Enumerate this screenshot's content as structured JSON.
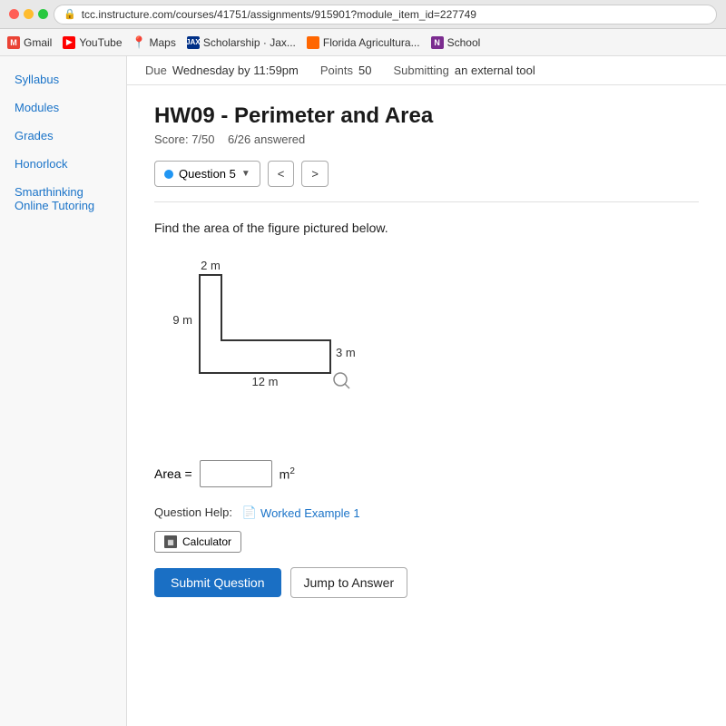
{
  "browser": {
    "url": "tcc.instructure.com/courses/41751/assignments/915901?module_item_id=227749",
    "lock_icon": "🔒"
  },
  "bookmarks": [
    {
      "id": "gmail",
      "label": "Gmail",
      "icon": "M",
      "color": "#EA4335"
    },
    {
      "id": "youtube",
      "label": "YouTube",
      "icon": "▶",
      "color": "#FF0000"
    },
    {
      "id": "maps",
      "label": "Maps",
      "icon": "📍",
      "color": "#4285F4"
    },
    {
      "id": "scholarship",
      "label": "Scholarship · Jax...",
      "icon": "JAX",
      "color": "#003087"
    },
    {
      "id": "famu",
      "label": "Florida Agricultura...",
      "icon": "F",
      "color": "#FF6600"
    },
    {
      "id": "school",
      "label": "School",
      "icon": "N",
      "color": "#7B2C8F"
    }
  ],
  "sidebar": {
    "items": [
      {
        "id": "syllabus",
        "label": "Syllabus"
      },
      {
        "id": "modules",
        "label": "Modules"
      },
      {
        "id": "grades",
        "label": "Grades"
      },
      {
        "id": "honorlock",
        "label": "Honorlock"
      },
      {
        "id": "smartinking",
        "label": "Smarthinking Online Tutoring"
      }
    ]
  },
  "top_bar": {
    "due_label": "Due",
    "due_value": "Wednesday by 11:59pm",
    "points_label": "Points",
    "points_value": "50",
    "submitting_label": "Submitting",
    "submitting_value": "an external tool"
  },
  "assignment": {
    "title": "HW09 - Perimeter and Area",
    "score_label": "Score:",
    "score_value": "7/50",
    "answered": "6/26 answered"
  },
  "question": {
    "nav_label": "Question 5",
    "prev_label": "<",
    "next_label": ">",
    "text": "Find the area of the figure pictured below.",
    "figure_labels": {
      "top": "2 m",
      "left": "9 m",
      "right": "3 m",
      "bottom": "12 m"
    },
    "area_label": "Area =",
    "area_unit": "m",
    "area_exponent": "2",
    "area_placeholder": ""
  },
  "help": {
    "label": "Question Help:",
    "worked_example": "Worked Example 1",
    "calculator_label": "Calculator"
  },
  "buttons": {
    "submit": "Submit Question",
    "jump": "Jump to Answer"
  }
}
